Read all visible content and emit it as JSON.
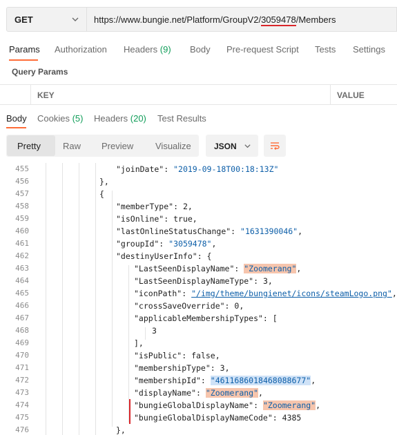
{
  "request": {
    "method": "GET",
    "url_prefix": "https://www.bungie.net/Platform/GroupV2/",
    "url_highlight": "3059478",
    "url_suffix": "/Members"
  },
  "request_tabs": [
    {
      "label": "Params",
      "count": ""
    },
    {
      "label": "Authorization",
      "count": ""
    },
    {
      "label": "Headers",
      "count": "(9)"
    },
    {
      "label": "Body",
      "count": ""
    },
    {
      "label": "Pre-request Script",
      "count": ""
    },
    {
      "label": "Tests",
      "count": ""
    },
    {
      "label": "Settings",
      "count": ""
    }
  ],
  "query_params": {
    "title": "Query Params",
    "key_header": "KEY",
    "value_header": "VALUE"
  },
  "response_tabs": [
    {
      "label": "Body",
      "count": ""
    },
    {
      "label": "Cookies",
      "count": "(5)"
    },
    {
      "label": "Headers",
      "count": "(20)"
    },
    {
      "label": "Test Results",
      "count": ""
    }
  ],
  "view_modes": [
    "Pretty",
    "Raw",
    "Preview",
    "Visualize"
  ],
  "format": "JSON",
  "code_lines": [
    {
      "n": "455",
      "a": "\"joinDate\": ",
      "b": "\"2019-09-18T00:18:13Z\"",
      "c": ""
    },
    {
      "n": "456",
      "a": "},",
      "b": "",
      "c": ""
    },
    {
      "n": "457",
      "a": "{",
      "b": "",
      "c": ""
    },
    {
      "n": "458",
      "a": "\"memberType\": ",
      "b": "2",
      "c": ","
    },
    {
      "n": "459",
      "a": "\"isOnline\": ",
      "b": "true",
      "c": ","
    },
    {
      "n": "460",
      "a": "\"lastOnlineStatusChange\": ",
      "b": "\"1631390046\"",
      "c": ","
    },
    {
      "n": "461",
      "a": "\"groupId\": ",
      "b": "\"3059478\"",
      "c": ","
    },
    {
      "n": "462",
      "a": "\"destinyUserInfo\": {",
      "b": "",
      "c": ""
    },
    {
      "n": "463",
      "a": "\"LastSeenDisplayName\": ",
      "b": "\"Zoomerang\"",
      "c": ","
    },
    {
      "n": "464",
      "a": "\"LastSeenDisplayNameType\": ",
      "b": "3",
      "c": ","
    },
    {
      "n": "465",
      "a": "\"iconPath\": ",
      "b": "\"/img/theme/bungienet/icons/steamLogo.png\"",
      "c": ","
    },
    {
      "n": "466",
      "a": "\"crossSaveOverride\": ",
      "b": "0",
      "c": ","
    },
    {
      "n": "467",
      "a": "\"applicableMembershipTypes\": [",
      "b": "",
      "c": ""
    },
    {
      "n": "468",
      "a": "3",
      "b": "",
      "c": ""
    },
    {
      "n": "469",
      "a": "],",
      "b": "",
      "c": ""
    },
    {
      "n": "470",
      "a": "\"isPublic\": ",
      "b": "false",
      "c": ","
    },
    {
      "n": "471",
      "a": "\"membershipType\": ",
      "b": "3",
      "c": ","
    },
    {
      "n": "472",
      "a": "\"membershipId\": ",
      "b": "\"4611686018468088677\"",
      "c": ","
    },
    {
      "n": "473",
      "a": "\"displayName\": ",
      "b": "\"Zoomerang\"",
      "c": ","
    },
    {
      "n": "474",
      "a": "\"bungieGlobalDisplayName\": ",
      "b": "\"Zoomerang\"",
      "c": ","
    },
    {
      "n": "475",
      "a": "\"bungieGlobalDisplayNameCode\": ",
      "b": "4385",
      "c": ""
    },
    {
      "n": "476",
      "a": "},",
      "b": "",
      "c": ""
    }
  ]
}
